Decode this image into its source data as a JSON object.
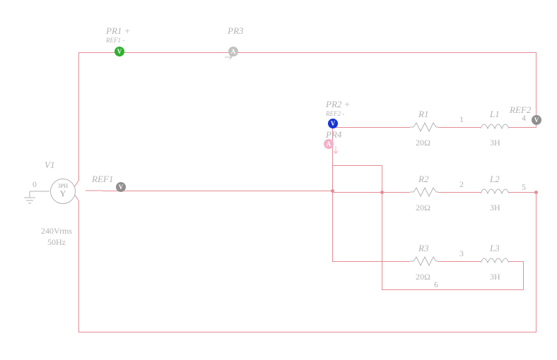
{
  "probes": {
    "pr1": {
      "label": "PR1 +",
      "ref": "REF1 -",
      "glyph": "V"
    },
    "pr2": {
      "label": "PR2 +",
      "ref": "REF2 -",
      "glyph": "V"
    },
    "pr3": {
      "label": "PR3",
      "glyph": "A"
    },
    "pr4": {
      "label": "PR4",
      "glyph": "A"
    },
    "ref1": {
      "label": "REF1",
      "glyph": "V"
    },
    "ref2": {
      "label": "REF2",
      "glyph": "V"
    }
  },
  "source": {
    "name": "V1",
    "type": "3PH",
    "symbol": "Y",
    "voltage": "240Vrms",
    "freq": "50Hz"
  },
  "components": {
    "R1": {
      "name": "R1",
      "value": "20Ω"
    },
    "R2": {
      "name": "R2",
      "value": "20Ω"
    },
    "R3": {
      "name": "R3",
      "value": "20Ω"
    },
    "L1": {
      "name": "L1",
      "value": "3H"
    },
    "L2": {
      "name": "L2",
      "value": "3H"
    },
    "L3": {
      "name": "L3",
      "value": "3H"
    }
  },
  "nodes": {
    "n0": "0",
    "n1": "1",
    "n2": "2",
    "n3": "3",
    "n4": "4",
    "n5": "5",
    "n6": "6"
  }
}
